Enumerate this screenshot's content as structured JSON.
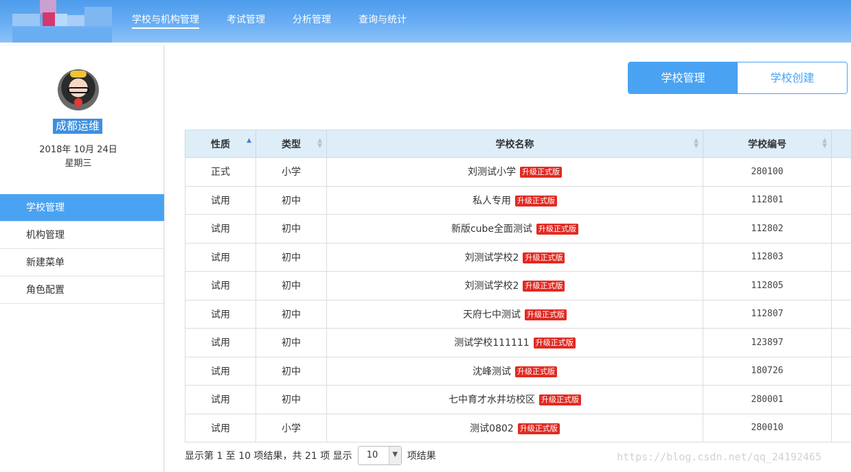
{
  "header": {
    "nav": [
      "学校与机构管理",
      "考试管理",
      "分析管理",
      "查询与统计"
    ]
  },
  "sidebar": {
    "username": "成都运维",
    "date": "2018年 10月 24日",
    "weekday": "星期三",
    "menu": [
      "学校管理",
      "机构管理",
      "新建菜单",
      "角色配置"
    ]
  },
  "main": {
    "tabs": [
      "学校管理",
      "学校创建"
    ],
    "table": {
      "headers": [
        "性质",
        "类型",
        "学校名称",
        "学校编号"
      ],
      "badge": "升级正式版",
      "rows": [
        {
          "nature": "正式",
          "type": "小学",
          "name": "刘测试小学",
          "code": "280100"
        },
        {
          "nature": "试用",
          "type": "初中",
          "name": "私人专用",
          "code": "112801"
        },
        {
          "nature": "试用",
          "type": "初中",
          "name": "新版cube全面测试",
          "code": "112802"
        },
        {
          "nature": "试用",
          "type": "初中",
          "name": "刘测试学校2",
          "code": "112803"
        },
        {
          "nature": "试用",
          "type": "初中",
          "name": "刘测试学校2",
          "code": "112805"
        },
        {
          "nature": "试用",
          "type": "初中",
          "name": "天府七中测试",
          "code": "112807"
        },
        {
          "nature": "试用",
          "type": "初中",
          "name": "测试学校111111",
          "code": "123897"
        },
        {
          "nature": "试用",
          "type": "初中",
          "name": "沈峰测试",
          "code": "180726"
        },
        {
          "nature": "试用",
          "type": "初中",
          "name": "七中育才水井坊校区",
          "code": "280001"
        },
        {
          "nature": "试用",
          "type": "小学",
          "name": "测试0802",
          "code": "280010"
        }
      ]
    },
    "footer": {
      "info": "显示第 1 至 10 项结果，共 21 项 显示",
      "page_size": "10",
      "suffix": "项结果"
    }
  },
  "watermark": "https://blog.csdn.net/qq_24192465"
}
